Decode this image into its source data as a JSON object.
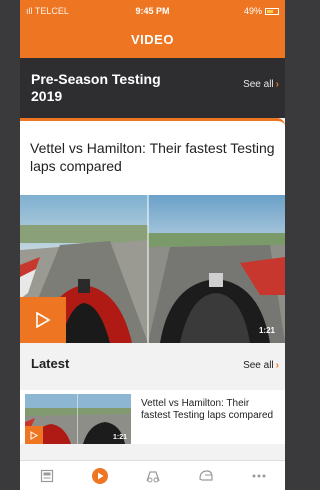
{
  "status_bar": {
    "carrier": "ıll TELCEL",
    "time": "9:45 PM",
    "battery": "49%"
  },
  "header": {
    "title": "VIDEO"
  },
  "section": {
    "title": "Pre-Season Testing 2019",
    "see_all": "See all"
  },
  "featured": {
    "title": "Vettel vs Hamilton: Their fastest Testing laps compared",
    "duration": "1:21"
  },
  "latest": {
    "title": "Latest",
    "see_all": "See all",
    "items": [
      {
        "title": "Vettel vs Hamilton: Their fastest Testing laps compared",
        "duration": "1:21"
      }
    ]
  },
  "tab_bar": {
    "items": [
      {
        "icon": "news-icon",
        "active": false
      },
      {
        "icon": "video-play-icon",
        "active": true
      },
      {
        "icon": "racing-icon",
        "active": false
      },
      {
        "icon": "helmet-icon",
        "active": false
      },
      {
        "icon": "more-icon",
        "active": false
      }
    ]
  },
  "colors": {
    "accent": "#ee7623",
    "dark_header": "#2e2e30",
    "background": "#f2f2f2"
  }
}
